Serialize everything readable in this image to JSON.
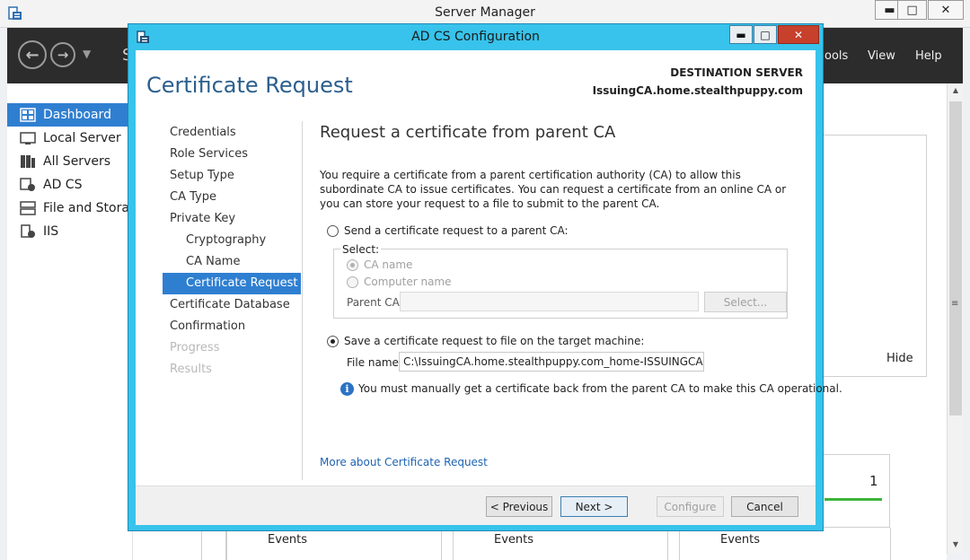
{
  "server_manager": {
    "title": "Server Manager",
    "window_buttons": {
      "minimize": "▬",
      "maximize": "□",
      "close": "✕"
    },
    "header": {
      "title_fragment": "S",
      "menu": [
        "Tools",
        "View",
        "Help"
      ],
      "menu_visible_text": [
        "ools",
        "View",
        "Help"
      ]
    },
    "sidebar": [
      {
        "label": "Dashboard",
        "icon": "dashboard-icon",
        "active": true
      },
      {
        "label": "Local Server",
        "icon": "server-icon"
      },
      {
        "label": "All Servers",
        "icon": "servers-icon"
      },
      {
        "label": "AD CS",
        "icon": "adcs-icon"
      },
      {
        "label": "File and Storage",
        "icon": "storage-icon"
      },
      {
        "label": "IIS",
        "icon": "iis-icon"
      }
    ],
    "hide_label": "Hide",
    "tile_count": "1",
    "events_labels": [
      "Events",
      "Events",
      "Events"
    ],
    "accent_color": "#2f7fd1"
  },
  "dialog": {
    "title": "AD CS Configuration",
    "frame_color": "#37c3eb",
    "page_title": "Certificate Request",
    "destination_label": "DESTINATION SERVER",
    "destination_server": "IssuingCA.home.stealthpuppy.com",
    "steps": [
      {
        "label": "Credentials",
        "state": "normal",
        "sub": false
      },
      {
        "label": "Role Services",
        "state": "normal",
        "sub": false
      },
      {
        "label": "Setup Type",
        "state": "normal",
        "sub": false
      },
      {
        "label": "CA Type",
        "state": "normal",
        "sub": false
      },
      {
        "label": "Private Key",
        "state": "normal",
        "sub": false
      },
      {
        "label": "Cryptography",
        "state": "normal",
        "sub": true
      },
      {
        "label": "CA Name",
        "state": "normal",
        "sub": true
      },
      {
        "label": "Certificate Request",
        "state": "current",
        "sub": true
      },
      {
        "label": "Certificate Database",
        "state": "normal",
        "sub": false
      },
      {
        "label": "Confirmation",
        "state": "normal",
        "sub": false
      },
      {
        "label": "Progress",
        "state": "disabled",
        "sub": false
      },
      {
        "label": "Results",
        "state": "disabled",
        "sub": false
      }
    ],
    "section_title": "Request a certificate from parent CA",
    "description": "You require a certificate from a parent certification authority (CA) to allow this subordinate CA to issue certificates. You can request a certificate from an online CA or you can store your request to a file to submit to the parent CA.",
    "option_send": "Send a certificate request to a parent CA:",
    "select_legend": "Select:",
    "option_ca_name": "CA name",
    "option_computer_name": "Computer name",
    "parent_ca_label": "Parent CA:",
    "parent_ca_value": "",
    "select_button": "Select...",
    "option_save": "Save a certificate request to file on the target machine:",
    "file_name_label": "File name:",
    "file_name_value": "C:\\IssuingCA.home.stealthpuppy.com_home-ISSUINGCA-CA.req",
    "info_text": "You must manually get a certificate back from the parent CA to make this CA operational.",
    "more_link": "More about Certificate Request",
    "buttons": {
      "previous": "< Previous",
      "next": "Next >",
      "configure": "Configure",
      "cancel": "Cancel"
    }
  }
}
